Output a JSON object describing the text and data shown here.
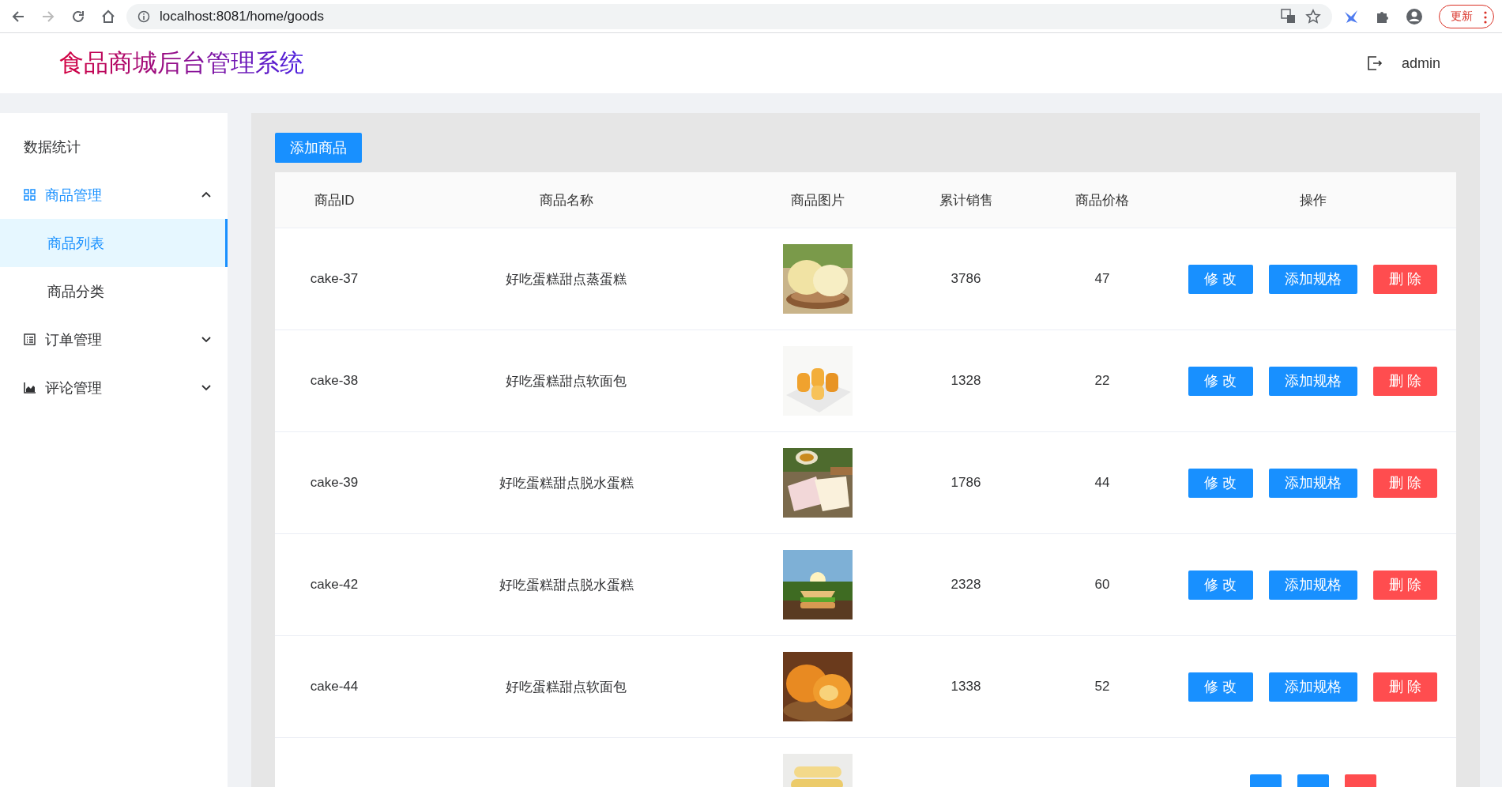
{
  "browser": {
    "url": "localhost:8081/home/goods",
    "back_disabled": false,
    "forward_disabled": true,
    "update_button": "更新"
  },
  "header": {
    "title": "食品商城后台管理系统",
    "user": "admin"
  },
  "sidebar": {
    "items": [
      {
        "label": "数据统计",
        "active": false
      },
      {
        "label": "商品管理",
        "expanded": true,
        "active": true,
        "children": [
          {
            "label": "商品列表",
            "selected": true
          },
          {
            "label": "商品分类",
            "selected": false
          }
        ]
      },
      {
        "label": "订单管理",
        "expanded": false,
        "active": false
      },
      {
        "label": "评论管理",
        "expanded": false,
        "active": false
      }
    ]
  },
  "toolbar": {
    "add_button": "添加商品"
  },
  "table": {
    "columns": [
      "商品ID",
      "商品名称",
      "商品图片",
      "累计销售",
      "商品价格",
      "操作"
    ],
    "rows": [
      {
        "id": "cake-37",
        "name": "好吃蛋糕甜点蒸蛋糕",
        "image": {
          "kind": "picture"
        },
        "sales": "3786",
        "price": "47",
        "actions": [
          {
            "label": "修 改",
            "kind": "primary"
          },
          {
            "label": "添加规格",
            "kind": "primary"
          },
          {
            "label": "删 除",
            "kind": "danger"
          }
        ]
      },
      {
        "id": "cake-38",
        "name": "好吃蛋糕甜点软面包",
        "image": {
          "kind": "picture"
        },
        "sales": "1328",
        "price": "22",
        "actions": [
          {
            "label": "修 改",
            "kind": "primary"
          },
          {
            "label": "添加规格",
            "kind": "primary"
          },
          {
            "label": "删 除",
            "kind": "danger"
          }
        ]
      },
      {
        "id": "cake-39",
        "name": "好吃蛋糕甜点脱水蛋糕",
        "image": {
          "kind": "picture"
        },
        "sales": "1786",
        "price": "44",
        "actions": [
          {
            "label": "修 改",
            "kind": "primary"
          },
          {
            "label": "添加规格",
            "kind": "primary"
          },
          {
            "label": "删 除",
            "kind": "danger"
          }
        ]
      },
      {
        "id": "cake-42",
        "name": "好吃蛋糕甜点脱水蛋糕",
        "image": {
          "kind": "picture"
        },
        "sales": "2328",
        "price": "60",
        "actions": [
          {
            "label": "修 改",
            "kind": "primary"
          },
          {
            "label": "添加规格",
            "kind": "primary"
          },
          {
            "label": "删 除",
            "kind": "danger"
          }
        ]
      },
      {
        "id": "cake-44",
        "name": "好吃蛋糕甜点软面包",
        "image": {
          "kind": "picture"
        },
        "sales": "1338",
        "price": "52",
        "actions": [
          {
            "label": "修 改",
            "kind": "primary"
          },
          {
            "label": "添加规格",
            "kind": "primary"
          },
          {
            "label": "删 除",
            "kind": "danger"
          }
        ]
      },
      {
        "image": {
          "kind": "picture"
        },
        "actions": [
          {
            "kind": "primary"
          },
          {
            "kind": "primary"
          },
          {
            "kind": "danger"
          }
        ]
      }
    ]
  }
}
